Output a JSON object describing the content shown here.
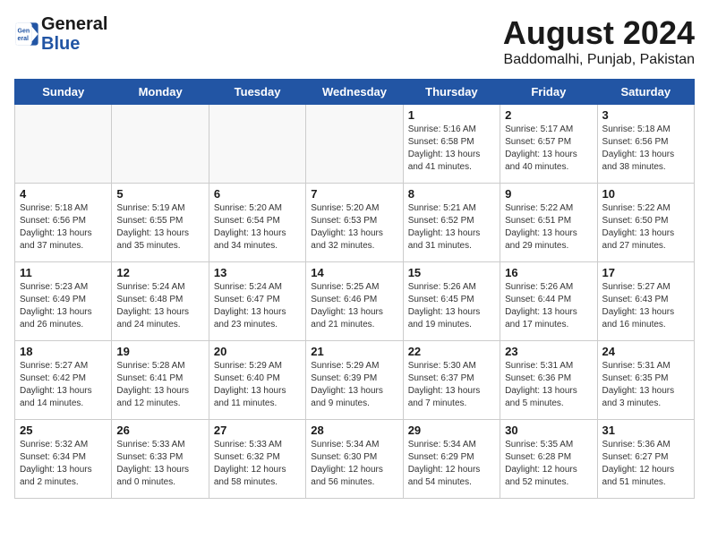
{
  "header": {
    "logo_line1": "General",
    "logo_line2": "Blue",
    "month_year": "August 2024",
    "location": "Baddomalhi, Punjab, Pakistan"
  },
  "weekdays": [
    "Sunday",
    "Monday",
    "Tuesday",
    "Wednesday",
    "Thursday",
    "Friday",
    "Saturday"
  ],
  "weeks": [
    [
      {
        "day": "",
        "info": ""
      },
      {
        "day": "",
        "info": ""
      },
      {
        "day": "",
        "info": ""
      },
      {
        "day": "",
        "info": ""
      },
      {
        "day": "1",
        "info": "Sunrise: 5:16 AM\nSunset: 6:58 PM\nDaylight: 13 hours\nand 41 minutes."
      },
      {
        "day": "2",
        "info": "Sunrise: 5:17 AM\nSunset: 6:57 PM\nDaylight: 13 hours\nand 40 minutes."
      },
      {
        "day": "3",
        "info": "Sunrise: 5:18 AM\nSunset: 6:56 PM\nDaylight: 13 hours\nand 38 minutes."
      }
    ],
    [
      {
        "day": "4",
        "info": "Sunrise: 5:18 AM\nSunset: 6:56 PM\nDaylight: 13 hours\nand 37 minutes."
      },
      {
        "day": "5",
        "info": "Sunrise: 5:19 AM\nSunset: 6:55 PM\nDaylight: 13 hours\nand 35 minutes."
      },
      {
        "day": "6",
        "info": "Sunrise: 5:20 AM\nSunset: 6:54 PM\nDaylight: 13 hours\nand 34 minutes."
      },
      {
        "day": "7",
        "info": "Sunrise: 5:20 AM\nSunset: 6:53 PM\nDaylight: 13 hours\nand 32 minutes."
      },
      {
        "day": "8",
        "info": "Sunrise: 5:21 AM\nSunset: 6:52 PM\nDaylight: 13 hours\nand 31 minutes."
      },
      {
        "day": "9",
        "info": "Sunrise: 5:22 AM\nSunset: 6:51 PM\nDaylight: 13 hours\nand 29 minutes."
      },
      {
        "day": "10",
        "info": "Sunrise: 5:22 AM\nSunset: 6:50 PM\nDaylight: 13 hours\nand 27 minutes."
      }
    ],
    [
      {
        "day": "11",
        "info": "Sunrise: 5:23 AM\nSunset: 6:49 PM\nDaylight: 13 hours\nand 26 minutes."
      },
      {
        "day": "12",
        "info": "Sunrise: 5:24 AM\nSunset: 6:48 PM\nDaylight: 13 hours\nand 24 minutes."
      },
      {
        "day": "13",
        "info": "Sunrise: 5:24 AM\nSunset: 6:47 PM\nDaylight: 13 hours\nand 23 minutes."
      },
      {
        "day": "14",
        "info": "Sunrise: 5:25 AM\nSunset: 6:46 PM\nDaylight: 13 hours\nand 21 minutes."
      },
      {
        "day": "15",
        "info": "Sunrise: 5:26 AM\nSunset: 6:45 PM\nDaylight: 13 hours\nand 19 minutes."
      },
      {
        "day": "16",
        "info": "Sunrise: 5:26 AM\nSunset: 6:44 PM\nDaylight: 13 hours\nand 17 minutes."
      },
      {
        "day": "17",
        "info": "Sunrise: 5:27 AM\nSunset: 6:43 PM\nDaylight: 13 hours\nand 16 minutes."
      }
    ],
    [
      {
        "day": "18",
        "info": "Sunrise: 5:27 AM\nSunset: 6:42 PM\nDaylight: 13 hours\nand 14 minutes."
      },
      {
        "day": "19",
        "info": "Sunrise: 5:28 AM\nSunset: 6:41 PM\nDaylight: 13 hours\nand 12 minutes."
      },
      {
        "day": "20",
        "info": "Sunrise: 5:29 AM\nSunset: 6:40 PM\nDaylight: 13 hours\nand 11 minutes."
      },
      {
        "day": "21",
        "info": "Sunrise: 5:29 AM\nSunset: 6:39 PM\nDaylight: 13 hours\nand 9 minutes."
      },
      {
        "day": "22",
        "info": "Sunrise: 5:30 AM\nSunset: 6:37 PM\nDaylight: 13 hours\nand 7 minutes."
      },
      {
        "day": "23",
        "info": "Sunrise: 5:31 AM\nSunset: 6:36 PM\nDaylight: 13 hours\nand 5 minutes."
      },
      {
        "day": "24",
        "info": "Sunrise: 5:31 AM\nSunset: 6:35 PM\nDaylight: 13 hours\nand 3 minutes."
      }
    ],
    [
      {
        "day": "25",
        "info": "Sunrise: 5:32 AM\nSunset: 6:34 PM\nDaylight: 13 hours\nand 2 minutes."
      },
      {
        "day": "26",
        "info": "Sunrise: 5:33 AM\nSunset: 6:33 PM\nDaylight: 13 hours\nand 0 minutes."
      },
      {
        "day": "27",
        "info": "Sunrise: 5:33 AM\nSunset: 6:32 PM\nDaylight: 12 hours\nand 58 minutes."
      },
      {
        "day": "28",
        "info": "Sunrise: 5:34 AM\nSunset: 6:30 PM\nDaylight: 12 hours\nand 56 minutes."
      },
      {
        "day": "29",
        "info": "Sunrise: 5:34 AM\nSunset: 6:29 PM\nDaylight: 12 hours\nand 54 minutes."
      },
      {
        "day": "30",
        "info": "Sunrise: 5:35 AM\nSunset: 6:28 PM\nDaylight: 12 hours\nand 52 minutes."
      },
      {
        "day": "31",
        "info": "Sunrise: 5:36 AM\nSunset: 6:27 PM\nDaylight: 12 hours\nand 51 minutes."
      }
    ]
  ]
}
